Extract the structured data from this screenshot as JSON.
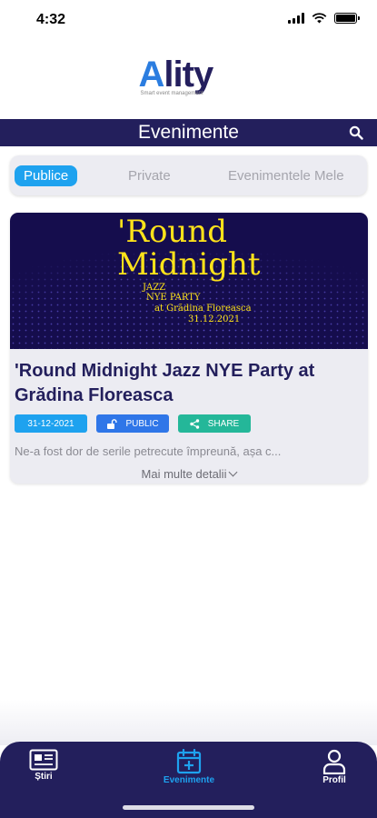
{
  "status_bar": {
    "time": "4:32"
  },
  "app": {
    "logo_a": "A",
    "logo_rest": "lity",
    "tagline": "Smart event management"
  },
  "header": {
    "title": "Evenimente"
  },
  "segments": [
    {
      "label": "Publice",
      "active": true
    },
    {
      "label": "Private",
      "active": false
    },
    {
      "label": "Evenimentele Mele",
      "active": false
    }
  ],
  "event": {
    "poster": {
      "line1": "'Round",
      "line2": "Midnight",
      "line3": "JAZZ",
      "line4": "NYE PARTY",
      "line5": "at Grădina Floreasca",
      "line6": "31.12.2021"
    },
    "title": "'Round Midnight Jazz NYE Party at Grădina Floreasca",
    "date": "31-12-2021",
    "visibility": "PUBLIC",
    "share": "SHARE",
    "excerpt": "Ne-a fost dor de serile petrecute împreună, așa c...",
    "more": "Mai multe detalii"
  },
  "tabbar": {
    "tabs": [
      {
        "label": "Știri",
        "icon": "newspaper-icon",
        "active": false
      },
      {
        "label": "Evenimente",
        "icon": "calendar-plus-icon",
        "active": true
      },
      {
        "label": "Profil",
        "icon": "user-icon",
        "active": false
      }
    ]
  },
  "colors": {
    "navy": "#231f5c",
    "accent": "#1ea2ef",
    "public": "#2f76e8",
    "share": "#24b799",
    "poster_yellow": "#ffe31a"
  }
}
